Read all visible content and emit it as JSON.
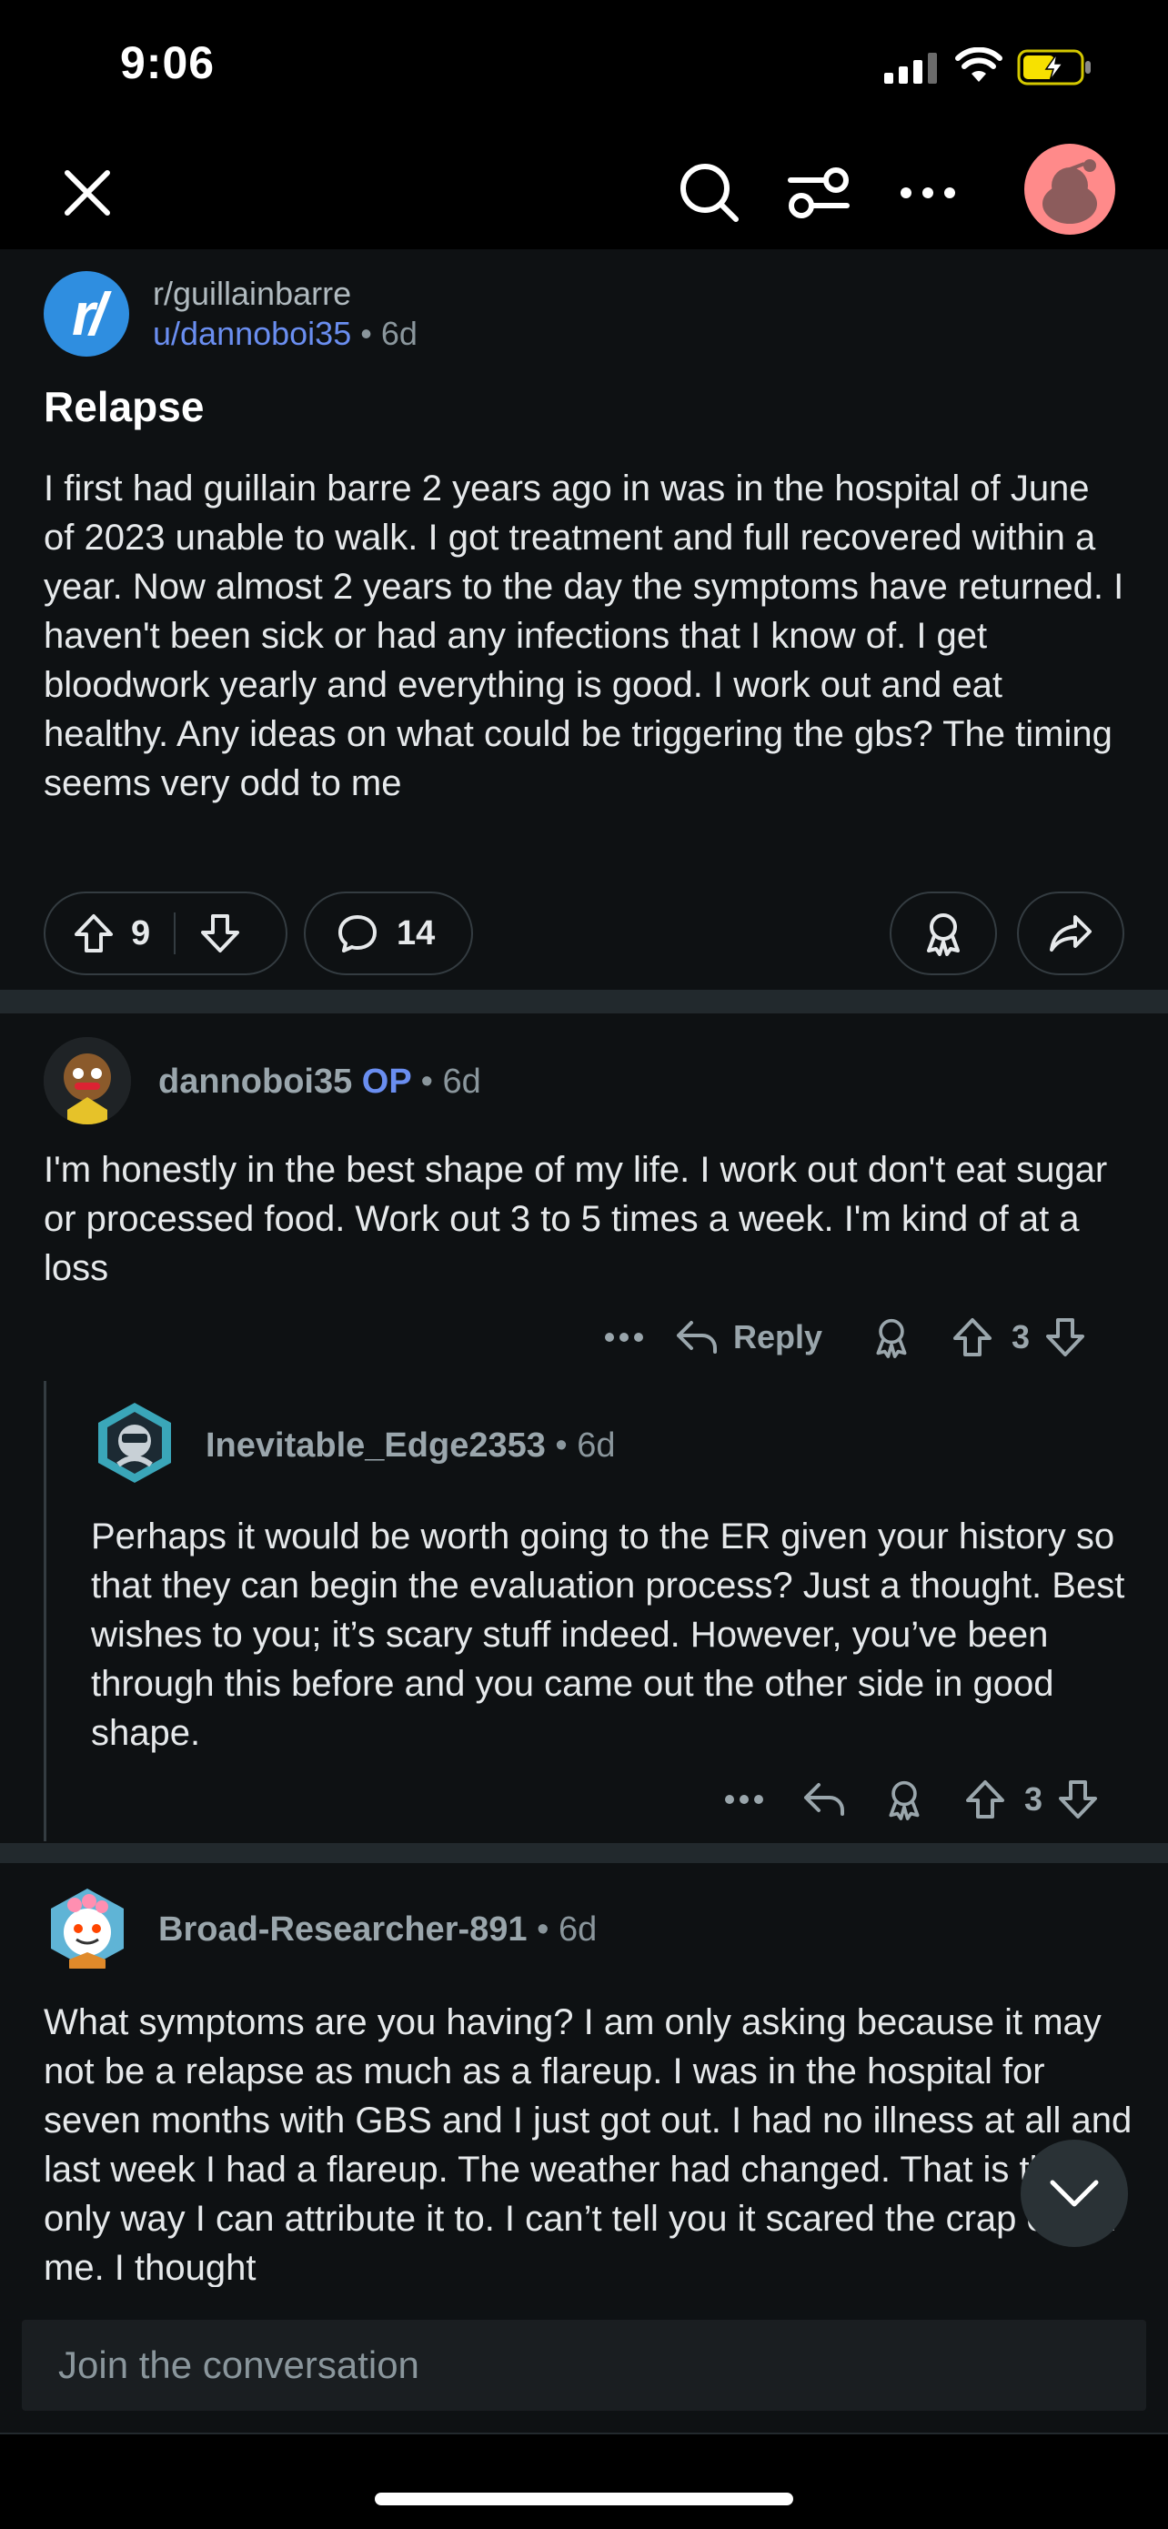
{
  "status_bar": {
    "time": "9:06"
  },
  "top_bar": {
    "icons": [
      "close-icon",
      "search-icon",
      "filter-icon",
      "more-icon",
      "avatar"
    ]
  },
  "post": {
    "subreddit": "r/guillainbarre",
    "subreddit_icon_text": "r/",
    "author": "u/dannoboi35",
    "separator": "•",
    "age": "6d",
    "title": "Relapse",
    "body": "I first had guillain barre 2 years ago in was in the hospital of June of 2023 unable to walk. I got treatment and full recovered within a year. Now almost 2 years to the day the symptoms have returned. I haven't been sick or had any infections that I know of. I get bloodwork yearly and everything is good. I work out and eat healthy. Any ideas on what could be triggering the gbs? The timing seems very odd to me",
    "score": "9",
    "comment_count": "14"
  },
  "comments": [
    {
      "username": "dannoboi35",
      "badge": "OP",
      "separator": "•",
      "age": "6d",
      "body": "I'm honestly in the best shape of my life. I work out don't eat sugar or processed food. Work out 3 to 5 times a week. I'm kind of at a loss",
      "reply_label": "Reply",
      "score": "3"
    },
    {
      "username": "Inevitable_Edge2353",
      "separator": "•",
      "age": "6d",
      "body": "Perhaps it would be worth going to the ER given your history so that they can begin the evaluation process? Just a thought. Best wishes to you; it’s scary stuff indeed. However, you’ve been through this before and you came out the other side in good shape.",
      "score": "3"
    },
    {
      "username": "Broad-Researcher-891",
      "separator": "•",
      "age": "6d",
      "body": "What symptoms are you having? I am only asking because it may not be a relapse as much as a flareup. I was in the hospital for seven months with GBS and I just got out. I had no illness at all and last week I had a flareup. The weather had changed. That is the only way I can attribute it to. I can’t tell you it scared the crap out of me. I thought"
    }
  ],
  "composer": {
    "placeholder": "Join the conversation"
  },
  "colors": {
    "background": "#0e1113",
    "accent": "#6a8ef0",
    "subreddit_icon": "#2f8ee0",
    "muted": "#8a969c"
  }
}
